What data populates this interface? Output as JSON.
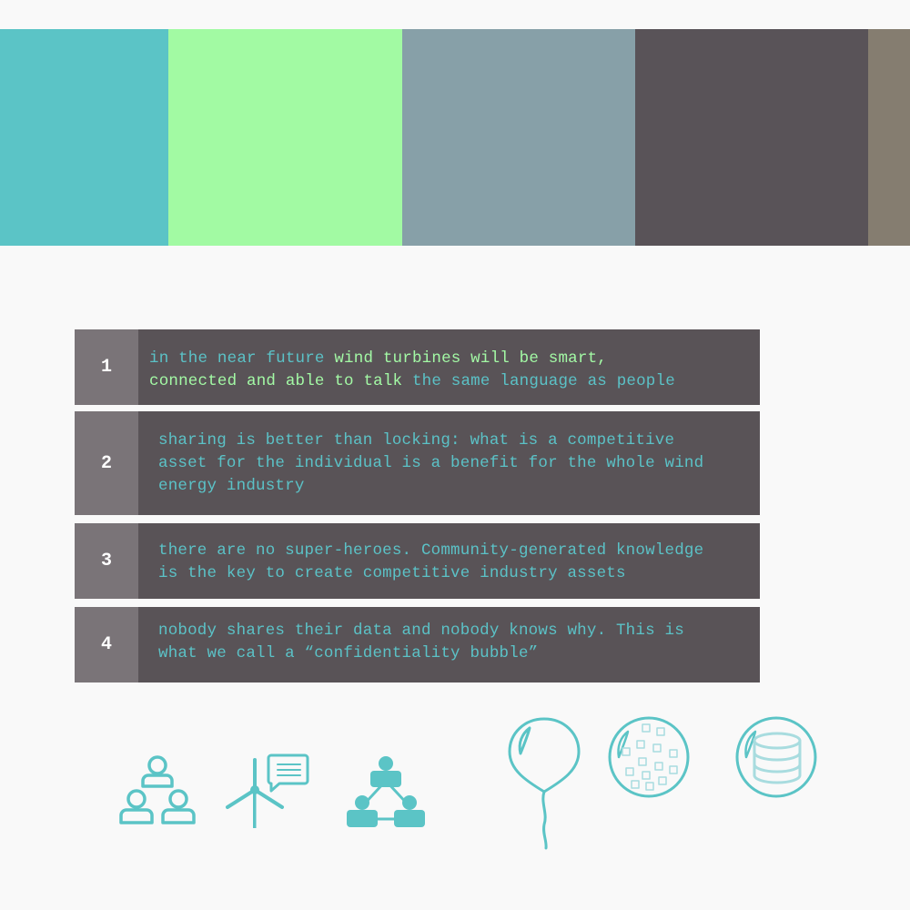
{
  "palette": {
    "swatches": [
      {
        "name": "teal",
        "color": "#5bc4c6"
      },
      {
        "name": "light-green",
        "color": "#a2faa3"
      },
      {
        "name": "slate-grey",
        "color": "#87a0a8"
      },
      {
        "name": "dark-purple-grey",
        "color": "#595358"
      },
      {
        "name": "warm-grey",
        "color": "#857d70"
      }
    ]
  },
  "statements": [
    {
      "number": "1",
      "lines": [
        [
          {
            "text": "in the near future ",
            "color": "teal"
          },
          {
            "text": "wind turbines will be smart,",
            "color": "green"
          }
        ],
        [
          {
            "text": "connected and able to talk ",
            "color": "green"
          },
          {
            "text": "the same language as people",
            "color": "teal"
          }
        ]
      ]
    },
    {
      "number": "2",
      "lines": [
        [
          {
            "text": "sharing is better than locking: what is a competitive",
            "color": "teal"
          }
        ],
        [
          {
            "text": "asset for the individual is a benefit for the whole wind",
            "color": "teal"
          }
        ],
        [
          {
            "text": "energy industry",
            "color": "teal"
          }
        ]
      ]
    },
    {
      "number": "3",
      "lines": [
        [
          {
            "text": "there are no super-heroes. Community-generated knowledge",
            "color": "teal"
          }
        ],
        [
          {
            "text": "is the key to create competitive industry assets",
            "color": "teal"
          }
        ]
      ]
    },
    {
      "number": "4",
      "lines": [
        [
          {
            "text": "nobody shares their data and nobody knows why. This is",
            "color": "teal"
          }
        ],
        [
          {
            "text": "what we call a “confidentiality bubble”",
            "color": "teal"
          }
        ]
      ]
    }
  ],
  "colors": {
    "statement_bg": "#595357",
    "number_bg": "#7a7478",
    "number_text": "#ffffff",
    "teal_text": "#5bc2c7",
    "green_text": "#a3f9a5",
    "icon": "#5bc4c6",
    "page_bg": "#f9f9f9"
  },
  "icons": [
    "community-people-icon",
    "wind-turbine-speech-icon",
    "network-people-icon",
    "balloon-icon",
    "data-bubble-icon",
    "database-bubble-icon"
  ]
}
